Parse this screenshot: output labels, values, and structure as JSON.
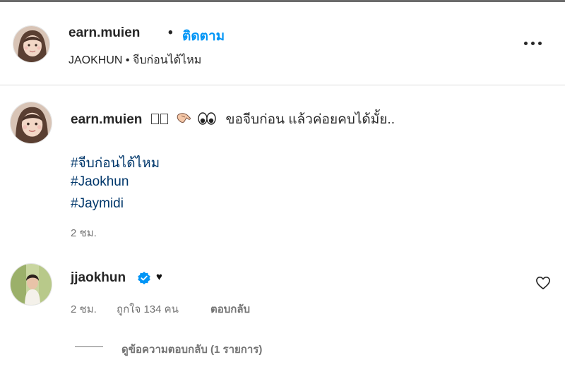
{
  "header": {
    "username": "earn.muien",
    "separator": "•",
    "follow_label": "ติดตาม",
    "subtitle": "JAOKHUN • จีบก่อนได้ไหม"
  },
  "caption": {
    "username": "earn.muien",
    "text": "ขอจีบก่อน แล้วค่อยคบได้มั้ย..",
    "hashtags": [
      "#จีบก่อนได้ไหม",
      "#Jaokhun",
      "#Jaymidi"
    ],
    "time": "2 ชม."
  },
  "comment": {
    "username": "jjaokhun",
    "verified": true,
    "heart_text": "♥",
    "time": "2 ชม.",
    "likes": "ถูกใจ 134 คน",
    "reply_label": "ตอบกลับ",
    "view_replies": "ดูข้อความตอบกลับ (1 รายการ)"
  },
  "icons": {
    "more": "more-options-icon",
    "like": "heart-outline-icon",
    "verified": "verified-badge-icon"
  },
  "colors": {
    "link_blue": "#0095f6",
    "hashtag": "#00376b",
    "secondary": "#737373",
    "primary_text": "#262626"
  }
}
